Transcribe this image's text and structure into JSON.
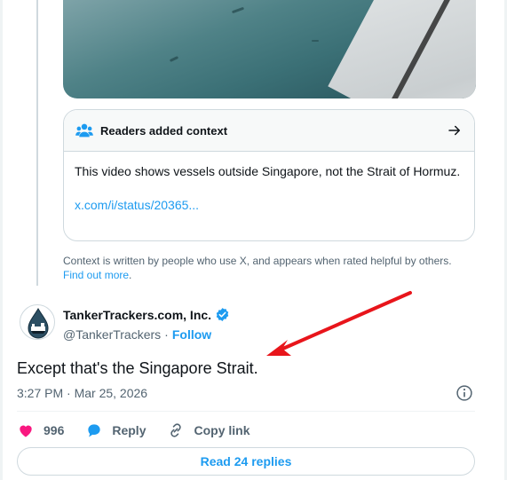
{
  "community_note": {
    "header_title": "Readers added context",
    "body_text": "This video shows vessels outside Singapore, not the Strait of Hormuz.",
    "link_text": "x.com/i/status/20365...",
    "disclaimer_text": "Context is written by people who use X, and appears when rated helpful by others.",
    "find_out_more": "Find out more",
    "period": "."
  },
  "tweet": {
    "author_name": "TankerTrackers.com, Inc.",
    "handle": "@TankerTrackers",
    "separator": "·",
    "follow_label": "Follow",
    "text": "Except that's the Singapore Strait.",
    "timestamp": "3:27 PM · Mar 25, 2026"
  },
  "actions": {
    "like_count": "996",
    "reply_label": "Reply",
    "copy_link_label": "Copy link"
  },
  "read_replies_label": "Read 24 replies",
  "colors": {
    "accent": "#1d9bf0",
    "like": "#f91880",
    "annotation_arrow": "#e8151b"
  }
}
